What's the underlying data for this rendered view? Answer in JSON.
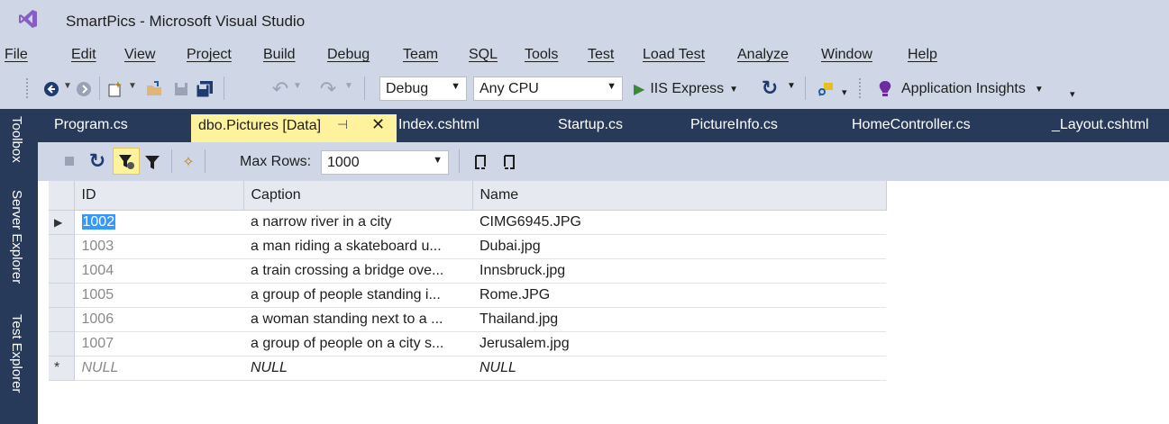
{
  "window": {
    "title": "SmartPics - Microsoft Visual Studio"
  },
  "menu": [
    "File",
    "Edit",
    "View",
    "Project",
    "Build",
    "Debug",
    "Team",
    "SQL",
    "Tools",
    "Test",
    "Load Test",
    "Analyze",
    "Window",
    "Help"
  ],
  "toolbar": {
    "configuration": "Debug",
    "platform": "Any CPU",
    "run_label": "IIS Express",
    "insights_label": "Application Insights"
  },
  "left_dock": [
    "Toolbox",
    "Server Explorer",
    "Test Explorer"
  ],
  "tabs": {
    "active": "dbo.Pictures [Data]",
    "others": [
      "Program.cs",
      "Index.cshtml",
      "Startup.cs",
      "PictureInfo.cs",
      "HomeController.cs",
      "_Layout.cshtml"
    ]
  },
  "editor_toolbar": {
    "max_rows_label": "Max Rows:",
    "max_rows_value": "1000"
  },
  "grid": {
    "columns": [
      "ID",
      "Caption",
      "Name"
    ],
    "rows": [
      {
        "id": "1002",
        "caption": "a narrow river in a city",
        "name": "CIMG6945.JPG"
      },
      {
        "id": "1003",
        "caption": "a man riding a skateboard u...",
        "name": "Dubai.jpg"
      },
      {
        "id": "1004",
        "caption": "a train crossing a bridge ove...",
        "name": "Innsbruck.jpg"
      },
      {
        "id": "1005",
        "caption": "a group of people standing i...",
        "name": "Rome.JPG"
      },
      {
        "id": "1006",
        "caption": "a woman standing next to a ...",
        "name": "Thailand.jpg"
      },
      {
        "id": "1007",
        "caption": "a group of people on a city s...",
        "name": "Jerusalem.jpg"
      }
    ],
    "new_row": {
      "id": "NULL",
      "caption": "NULL",
      "name": "NULL"
    }
  },
  "colors": {
    "chrome": "#cfd6e5",
    "dock": "#283a5a",
    "active_tab": "#fff29d",
    "selection": "#3399ff"
  }
}
